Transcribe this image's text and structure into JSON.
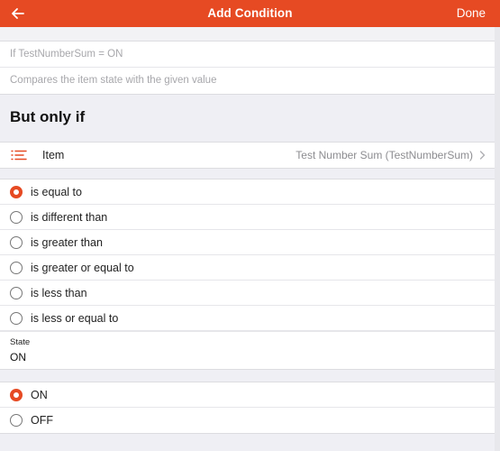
{
  "navbar": {
    "back_icon": "arrow-left-icon",
    "title": "Add Condition",
    "done_label": "Done"
  },
  "header_group": {
    "condition_text": "If TestNumberSum = ON",
    "description": "Compares the item state with the given value"
  },
  "section_title": "But only if",
  "item": {
    "icon": "list-icon",
    "label": "Item",
    "value": "Test Number Sum (TestNumberSum)",
    "chevron_icon": "chevron-right-icon"
  },
  "operators": {
    "selected_index": 0,
    "options": [
      {
        "label": "is equal to",
        "selected": true
      },
      {
        "label": "is different than",
        "selected": false
      },
      {
        "label": "is greater than",
        "selected": false
      },
      {
        "label": "is greater or equal to",
        "selected": false
      },
      {
        "label": "is less than",
        "selected": false
      },
      {
        "label": "is less or equal to",
        "selected": false
      }
    ]
  },
  "state": {
    "label": "State",
    "value": "ON"
  },
  "state_options": {
    "options": [
      {
        "label": "ON",
        "selected": true
      },
      {
        "label": "OFF",
        "selected": false
      }
    ]
  },
  "colors": {
    "accent": "#e64a23",
    "background": "#efeff4"
  }
}
